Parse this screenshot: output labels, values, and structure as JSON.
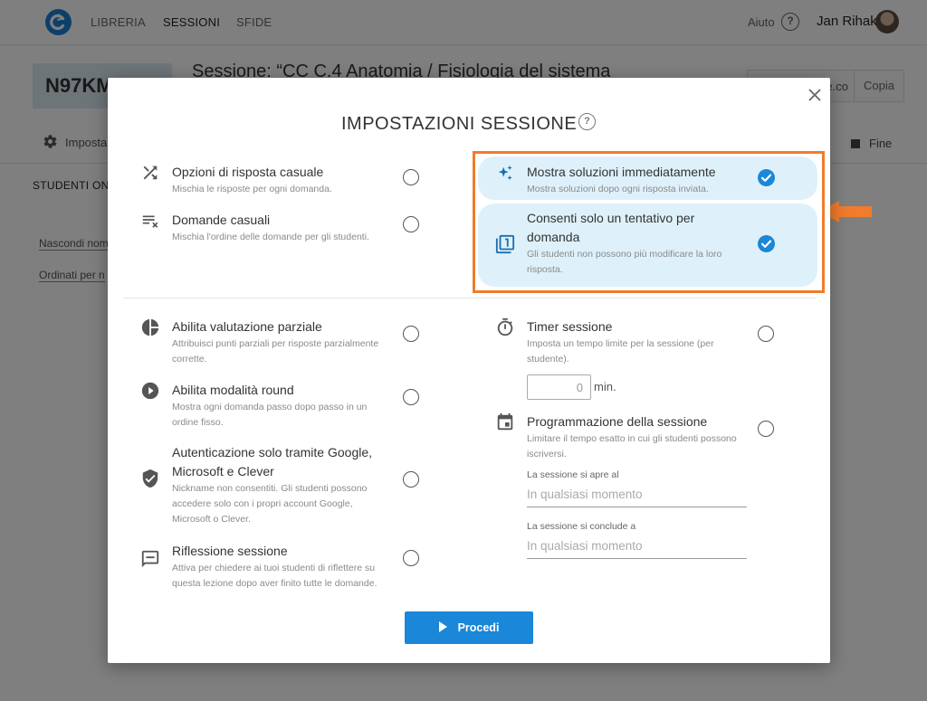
{
  "nav": {
    "links": [
      "LIBRERIA",
      "SESSIONI",
      "SFIDE"
    ],
    "help_label": "Aiuto",
    "help_icon": "?",
    "user_name": "Jan Rihak"
  },
  "session": {
    "code": "N97KM...",
    "title": "Sessione: “CC C.4 Anatomia / Fisiologia del sistema",
    "share_url": "e.co",
    "copy_label": "Copia",
    "settings_tab": "Imposta",
    "end_label": "Fine",
    "students_online": "STUDENTI ONL",
    "hide_names": "Nascondi nom",
    "sort_by": "Ordinati per n"
  },
  "modal": {
    "title": "IMPOSTAZIONI SESSIONE",
    "help_icon": "?",
    "options": {
      "random_answers": {
        "label": "Opzioni di risposta casuale",
        "desc": "Mischia le risposte per ogni domanda.",
        "checked": false
      },
      "random_questions": {
        "label": "Domande casuali",
        "desc": "Mischia l'ordine delle domande per gli studenti.",
        "checked": false
      },
      "show_solutions": {
        "label": "Mostra soluzioni immediatamente",
        "desc": "Mostra soluzioni dopo ogni risposta inviata.",
        "checked": true
      },
      "one_attempt": {
        "label_1": "Consenti solo un tentativo per",
        "label_2": "domanda",
        "desc_1": "Gli studenti non possono più modificare la loro",
        "desc_2": "risposta.",
        "checked": true
      },
      "partial_grading": {
        "label": "Abilita valutazione parziale",
        "desc_1": "Attribuisci punti parziali per risposte parzialmente",
        "desc_2": "corrette.",
        "checked": false
      },
      "round_mode": {
        "label": "Abilita modalità round",
        "desc_1": "Mostra ogni domanda passo dopo passo in un",
        "desc_2": "ordine fisso.",
        "checked": false
      },
      "google_auth": {
        "label_1": "Autenticazione solo tramite Google,",
        "label_2": "Microsoft e Clever",
        "desc_1": "Nickname non consentiti. Gli studenti possono",
        "desc_2": "accedere solo con i propri account Google,",
        "desc_3": "Microsoft o Clever.",
        "checked": false
      },
      "reflection": {
        "label": "Riflessione sessione",
        "desc_1": "Attiva per chiedere ai tuoi studenti di riflettere su",
        "desc_2": "questa lezione dopo aver finito tutte le domande.",
        "checked": false
      },
      "timer": {
        "label": "Timer sessione",
        "desc_1": "Imposta un tempo limite per la sessione (per",
        "desc_2": "studente).",
        "value": "0",
        "unit": "min.",
        "checked": false
      },
      "schedule": {
        "label": "Programmazione della sessione",
        "desc_1": "Limitare il tempo esatto in cui gli studenti possono",
        "desc_2": "iscriversi.",
        "opens_label": "La sessione si apre al",
        "opens_placeholder": "In qualsiasi momento",
        "closes_label": "La sessione si conclude a",
        "closes_placeholder": "In qualsiasi momento",
        "checked": false
      }
    },
    "proceed_label": "Procedi"
  },
  "colors": {
    "accent": "#1a87d8",
    "highlight_bg": "#def1fa",
    "annotation": "#f07c2c"
  }
}
